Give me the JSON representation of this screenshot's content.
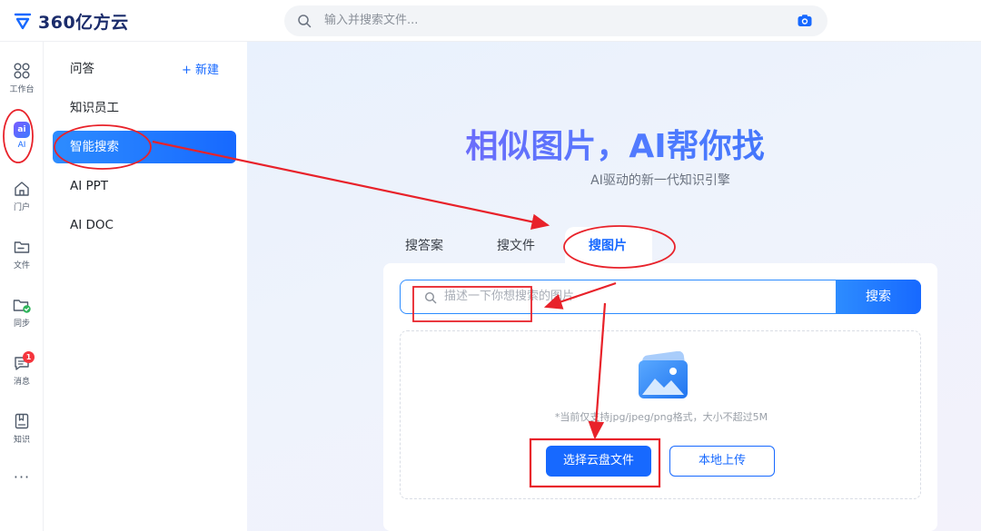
{
  "app": {
    "logo_text": "360亿方云"
  },
  "topbar": {
    "search_placeholder": "输入并搜索文件..."
  },
  "rail": {
    "items": [
      {
        "label": "工作台"
      },
      {
        "label": "AI",
        "icon_text": "ai"
      },
      {
        "label": "门户"
      },
      {
        "label": "文件"
      },
      {
        "label": "同步"
      },
      {
        "label": "消息",
        "badge": "1"
      },
      {
        "label": "知识"
      }
    ],
    "more": "···"
  },
  "sidebar": {
    "header": "问答",
    "new_label": "+ 新建",
    "items": [
      {
        "label": "知识员工"
      },
      {
        "label": "智能搜索",
        "active": true
      },
      {
        "label": "AI PPT"
      },
      {
        "label": "AI DOC"
      }
    ]
  },
  "main": {
    "title": "相似图片，AI帮你找",
    "subtitle": "AI驱动的新一代知识引擎",
    "tabs": [
      {
        "label": "搜答案"
      },
      {
        "label": "搜文件"
      },
      {
        "label": "搜图片",
        "active": true
      }
    ],
    "query_placeholder": "描述一下你想搜索的图片",
    "search_button": "搜索",
    "upload_hint": "*当前仅支持jpg/jpeg/png格式，大小不超过5M",
    "cloud_button": "选择云盘文件",
    "local_button": "本地上传"
  },
  "colors": {
    "accent": "#1769ff",
    "annotation": "#e8222a"
  }
}
